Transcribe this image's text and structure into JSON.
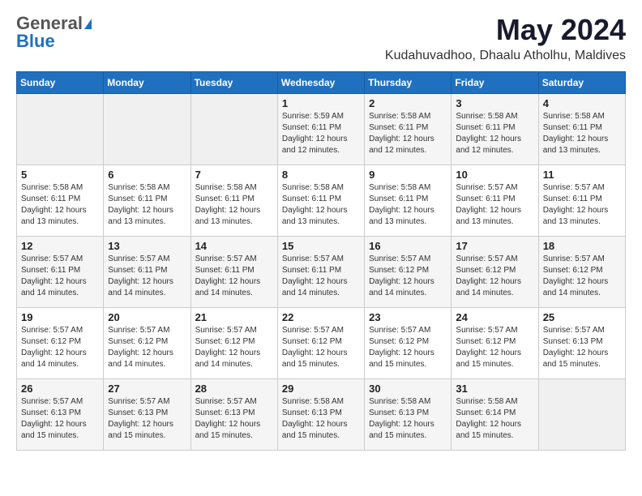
{
  "logo": {
    "general": "General",
    "blue": "Blue"
  },
  "title": "May 2024",
  "location": "Kudahuvadhoo, Dhaalu Atholhu, Maldives",
  "days_of_week": [
    "Sunday",
    "Monday",
    "Tuesday",
    "Wednesday",
    "Thursday",
    "Friday",
    "Saturday"
  ],
  "weeks": [
    [
      {
        "day": "",
        "sunrise": "",
        "sunset": "",
        "daylight": ""
      },
      {
        "day": "",
        "sunrise": "",
        "sunset": "",
        "daylight": ""
      },
      {
        "day": "",
        "sunrise": "",
        "sunset": "",
        "daylight": ""
      },
      {
        "day": "1",
        "sunrise": "Sunrise: 5:59 AM",
        "sunset": "Sunset: 6:11 PM",
        "daylight": "Daylight: 12 hours and 12 minutes."
      },
      {
        "day": "2",
        "sunrise": "Sunrise: 5:58 AM",
        "sunset": "Sunset: 6:11 PM",
        "daylight": "Daylight: 12 hours and 12 minutes."
      },
      {
        "day": "3",
        "sunrise": "Sunrise: 5:58 AM",
        "sunset": "Sunset: 6:11 PM",
        "daylight": "Daylight: 12 hours and 12 minutes."
      },
      {
        "day": "4",
        "sunrise": "Sunrise: 5:58 AM",
        "sunset": "Sunset: 6:11 PM",
        "daylight": "Daylight: 12 hours and 13 minutes."
      }
    ],
    [
      {
        "day": "5",
        "sunrise": "Sunrise: 5:58 AM",
        "sunset": "Sunset: 6:11 PM",
        "daylight": "Daylight: 12 hours and 13 minutes."
      },
      {
        "day": "6",
        "sunrise": "Sunrise: 5:58 AM",
        "sunset": "Sunset: 6:11 PM",
        "daylight": "Daylight: 12 hours and 13 minutes."
      },
      {
        "day": "7",
        "sunrise": "Sunrise: 5:58 AM",
        "sunset": "Sunset: 6:11 PM",
        "daylight": "Daylight: 12 hours and 13 minutes."
      },
      {
        "day": "8",
        "sunrise": "Sunrise: 5:58 AM",
        "sunset": "Sunset: 6:11 PM",
        "daylight": "Daylight: 12 hours and 13 minutes."
      },
      {
        "day": "9",
        "sunrise": "Sunrise: 5:58 AM",
        "sunset": "Sunset: 6:11 PM",
        "daylight": "Daylight: 12 hours and 13 minutes."
      },
      {
        "day": "10",
        "sunrise": "Sunrise: 5:57 AM",
        "sunset": "Sunset: 6:11 PM",
        "daylight": "Daylight: 12 hours and 13 minutes."
      },
      {
        "day": "11",
        "sunrise": "Sunrise: 5:57 AM",
        "sunset": "Sunset: 6:11 PM",
        "daylight": "Daylight: 12 hours and 13 minutes."
      }
    ],
    [
      {
        "day": "12",
        "sunrise": "Sunrise: 5:57 AM",
        "sunset": "Sunset: 6:11 PM",
        "daylight": "Daylight: 12 hours and 14 minutes."
      },
      {
        "day": "13",
        "sunrise": "Sunrise: 5:57 AM",
        "sunset": "Sunset: 6:11 PM",
        "daylight": "Daylight: 12 hours and 14 minutes."
      },
      {
        "day": "14",
        "sunrise": "Sunrise: 5:57 AM",
        "sunset": "Sunset: 6:11 PM",
        "daylight": "Daylight: 12 hours and 14 minutes."
      },
      {
        "day": "15",
        "sunrise": "Sunrise: 5:57 AM",
        "sunset": "Sunset: 6:11 PM",
        "daylight": "Daylight: 12 hours and 14 minutes."
      },
      {
        "day": "16",
        "sunrise": "Sunrise: 5:57 AM",
        "sunset": "Sunset: 6:12 PM",
        "daylight": "Daylight: 12 hours and 14 minutes."
      },
      {
        "day": "17",
        "sunrise": "Sunrise: 5:57 AM",
        "sunset": "Sunset: 6:12 PM",
        "daylight": "Daylight: 12 hours and 14 minutes."
      },
      {
        "day": "18",
        "sunrise": "Sunrise: 5:57 AM",
        "sunset": "Sunset: 6:12 PM",
        "daylight": "Daylight: 12 hours and 14 minutes."
      }
    ],
    [
      {
        "day": "19",
        "sunrise": "Sunrise: 5:57 AM",
        "sunset": "Sunset: 6:12 PM",
        "daylight": "Daylight: 12 hours and 14 minutes."
      },
      {
        "day": "20",
        "sunrise": "Sunrise: 5:57 AM",
        "sunset": "Sunset: 6:12 PM",
        "daylight": "Daylight: 12 hours and 14 minutes."
      },
      {
        "day": "21",
        "sunrise": "Sunrise: 5:57 AM",
        "sunset": "Sunset: 6:12 PM",
        "daylight": "Daylight: 12 hours and 14 minutes."
      },
      {
        "day": "22",
        "sunrise": "Sunrise: 5:57 AM",
        "sunset": "Sunset: 6:12 PM",
        "daylight": "Daylight: 12 hours and 15 minutes."
      },
      {
        "day": "23",
        "sunrise": "Sunrise: 5:57 AM",
        "sunset": "Sunset: 6:12 PM",
        "daylight": "Daylight: 12 hours and 15 minutes."
      },
      {
        "day": "24",
        "sunrise": "Sunrise: 5:57 AM",
        "sunset": "Sunset: 6:12 PM",
        "daylight": "Daylight: 12 hours and 15 minutes."
      },
      {
        "day": "25",
        "sunrise": "Sunrise: 5:57 AM",
        "sunset": "Sunset: 6:13 PM",
        "daylight": "Daylight: 12 hours and 15 minutes."
      }
    ],
    [
      {
        "day": "26",
        "sunrise": "Sunrise: 5:57 AM",
        "sunset": "Sunset: 6:13 PM",
        "daylight": "Daylight: 12 hours and 15 minutes."
      },
      {
        "day": "27",
        "sunrise": "Sunrise: 5:57 AM",
        "sunset": "Sunset: 6:13 PM",
        "daylight": "Daylight: 12 hours and 15 minutes."
      },
      {
        "day": "28",
        "sunrise": "Sunrise: 5:57 AM",
        "sunset": "Sunset: 6:13 PM",
        "daylight": "Daylight: 12 hours and 15 minutes."
      },
      {
        "day": "29",
        "sunrise": "Sunrise: 5:58 AM",
        "sunset": "Sunset: 6:13 PM",
        "daylight": "Daylight: 12 hours and 15 minutes."
      },
      {
        "day": "30",
        "sunrise": "Sunrise: 5:58 AM",
        "sunset": "Sunset: 6:13 PM",
        "daylight": "Daylight: 12 hours and 15 minutes."
      },
      {
        "day": "31",
        "sunrise": "Sunrise: 5:58 AM",
        "sunset": "Sunset: 6:14 PM",
        "daylight": "Daylight: 12 hours and 15 minutes."
      },
      {
        "day": "",
        "sunrise": "",
        "sunset": "",
        "daylight": ""
      }
    ]
  ]
}
